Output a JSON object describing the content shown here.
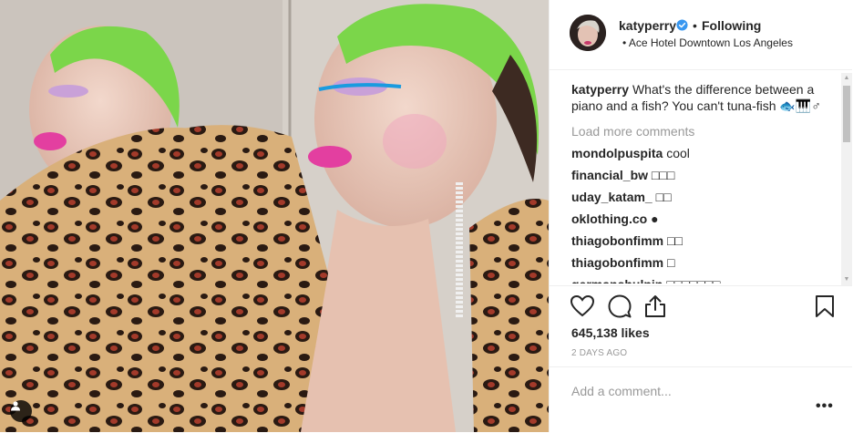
{
  "post": {
    "username": "katyperry",
    "separator": "•",
    "follow_label": "Following",
    "location": "• Ace Hotel Downtown Los Angeles"
  },
  "caption": {
    "username": "katyperry",
    "text": "What's the difference between a piano and a fish? You can't tuna-fish 🐟🎹♂"
  },
  "load_more_label": "Load more comments",
  "comments": [
    {
      "user": "mondolpuspita",
      "text": "cool"
    },
    {
      "user": "financial_bw",
      "text": "□□□"
    },
    {
      "user": "uday_katam_",
      "text": "□□"
    },
    {
      "user": "oklothing.co",
      "text": "●"
    },
    {
      "user": "thiagobonfimm",
      "text": "□□"
    },
    {
      "user": "thiagobonfimm",
      "text": "□"
    },
    {
      "user": "germanshulpin",
      "text": "□□□□□□□"
    }
  ],
  "likes": "645,138 likes",
  "time_ago": "2 DAYS AGO",
  "add_comment_placeholder": "Add a comment...",
  "more_options": "•••",
  "icons": {
    "like": "heart-icon",
    "comment": "comment-icon",
    "share": "share-icon",
    "save": "bookmark-icon",
    "verified": "verified-badge-icon",
    "tagged": "user-tag-icon"
  },
  "colors": {
    "verified_blue": "#3897f0",
    "secondary_text": "#999999",
    "divider": "#efefef"
  }
}
